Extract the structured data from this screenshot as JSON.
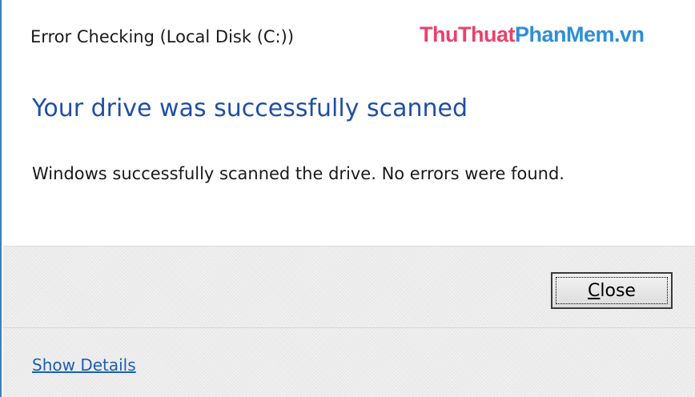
{
  "window": {
    "title": "Error Checking (Local Disk (C:))"
  },
  "watermark": {
    "part1": "ThuThuat",
    "part2": "PhanMem.vn"
  },
  "content": {
    "main_instruction": "Your drive was successfully scanned",
    "body": "Windows successfully scanned the drive. No errors were found."
  },
  "buttons": {
    "close_mnemonic": "C",
    "close_rest": "lose"
  },
  "footer": {
    "details_link": "Show Details"
  },
  "colors": {
    "border_accent": "#3c7fc0",
    "instruction_blue": "#1f4fa6",
    "link_blue": "#1a5fb4",
    "watermark_pink": "#e8426b",
    "watermark_blue": "#2d8fd6"
  }
}
